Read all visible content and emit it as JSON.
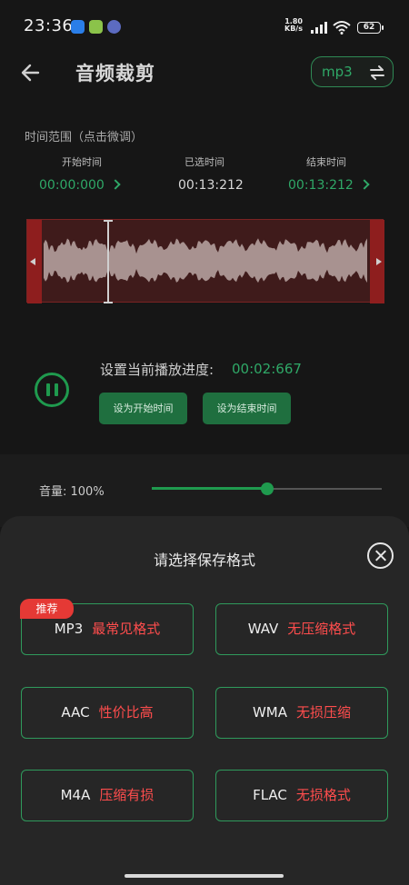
{
  "status_bar": {
    "time": "23:36",
    "net_speed_value": "1.80",
    "net_speed_unit": "KB/s",
    "battery": "62"
  },
  "header": {
    "title": "音频裁剪",
    "format": "mp3"
  },
  "time_range": {
    "label": "时间范围（点击微调）",
    "start_label": "开始时间",
    "start_value": "00:00:000",
    "selected_label": "已选时间",
    "selected_value": "00:13:212",
    "end_label": "结束时间",
    "end_value": "00:13:212"
  },
  "playback": {
    "progress_label": "设置当前播放进度:",
    "progress_value": "00:02:667",
    "set_start_button": "设为开始时间",
    "set_end_button": "设为结束时间"
  },
  "volume": {
    "label": "音量: 100%",
    "level_fraction": 0.5
  },
  "save_sheet": {
    "title": "请选择保存格式",
    "badge": "推荐",
    "options": [
      {
        "name": "MP3",
        "desc": "最常见格式"
      },
      {
        "name": "WAV",
        "desc": "无压缩格式"
      },
      {
        "name": "AAC",
        "desc": "性价比高"
      },
      {
        "name": "WMA",
        "desc": "无损压缩"
      },
      {
        "name": "M4A",
        "desc": "压缩有损"
      },
      {
        "name": "FLAC",
        "desc": "无损格式"
      }
    ]
  },
  "colors": {
    "accent_green": "#2fa867",
    "warning_red": "#ff4d4d",
    "waveform_bg": "#3f1b1b"
  }
}
